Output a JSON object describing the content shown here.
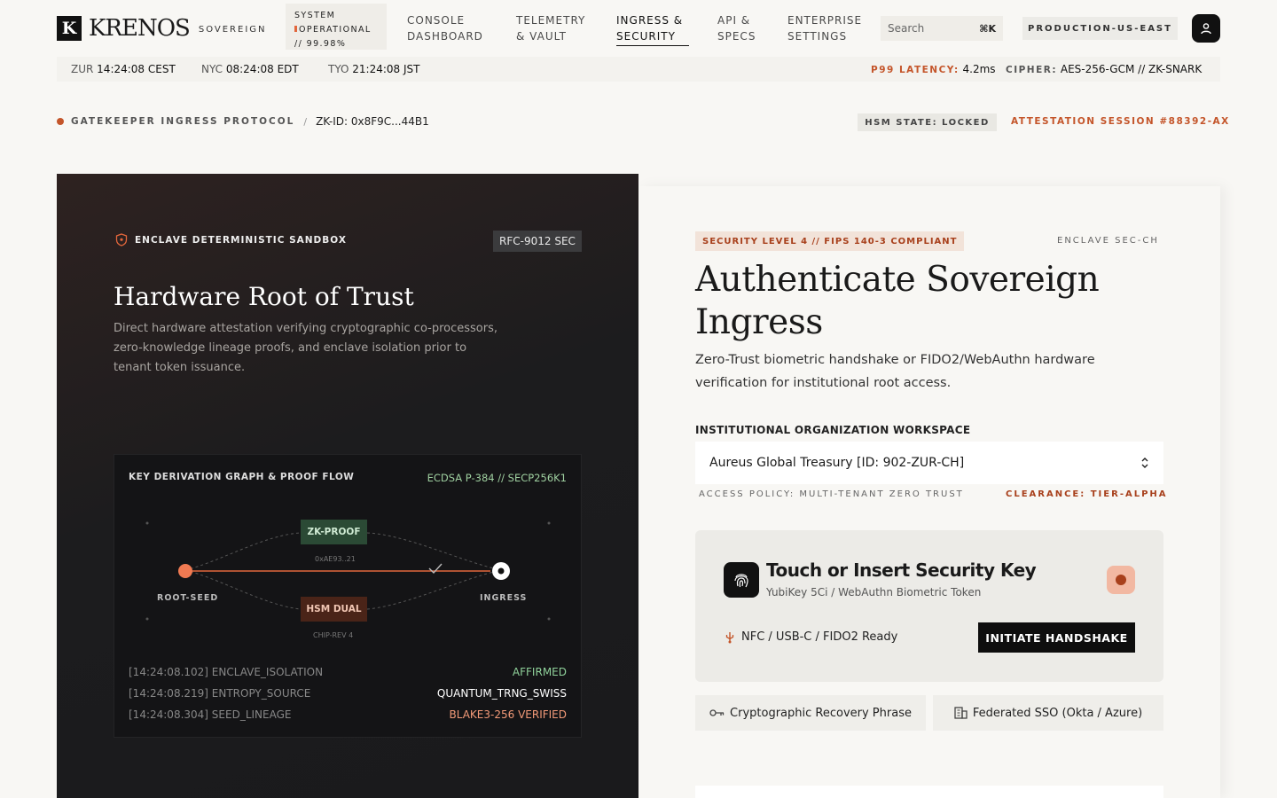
{
  "brand": {
    "mark": "K",
    "name": "KRENOS",
    "sub": "SOVEREIGN"
  },
  "system": {
    "line1": "SYSTEM",
    "line2": "OPERATIONAL",
    "line3": "// 99.98%"
  },
  "nav": [
    {
      "l1": "CONSOLE",
      "l2": "DASHBOARD"
    },
    {
      "l1": "TELEMETRY",
      "l2": "& VAULT"
    },
    {
      "l1": "INGRESS &",
      "l2": "SECURITY"
    },
    {
      "l1": "API &",
      "l2": "SPECS"
    },
    {
      "l1": "ENTERPRISE",
      "l2": "SETTINGS"
    }
  ],
  "search": {
    "placeholder": "Search",
    "shortcut": "⌘K"
  },
  "env": "PRODUCTION-US-EAST",
  "timebar": {
    "zur_label": "ZUR",
    "zur_time": "14:24:08 CEST",
    "nyc_label": "NYC",
    "nyc_time": "08:24:08 EDT",
    "tyo_label": "TYO",
    "tyo_time": "21:24:08 JST",
    "latency_label": "P99 LATENCY:",
    "latency_value": "4.2ms",
    "cipher_label": "CIPHER:",
    "cipher_value": "AES-256-GCM // ZK-SNARK"
  },
  "breadcrumb": {
    "protocol": "GATEKEEPER INGRESS PROTOCOL",
    "sep": "/",
    "zk": "ZK-ID: 0x8F9C...44B1"
  },
  "hsm_state": "HSM STATE: LOCKED",
  "attestation": "ATTESTATION SESSION #88392-AX",
  "left": {
    "sandbox": "ENCLAVE DETERMINISTIC SANDBOX",
    "rfc": "RFC-9012 SEC",
    "title": "Hardware Root of Trust",
    "desc": "Direct hardware attestation verifying cryptographic co-processors, zero-knowledge lineage proofs, and enclave isolation prior to tenant token issuance.",
    "graph": {
      "title": "KEY DERIVATION GRAPH & PROOF FLOW",
      "algo": "ECDSA P-384 // SECP256K1",
      "root": "ROOT-SEED",
      "ingress": "INGRESS",
      "zk": "ZK-PROOF",
      "zk_hash": "0xAE93..21",
      "hsm": "HSM DUAL",
      "hsm_rev": "CHIP-REV 4"
    },
    "logs": [
      {
        "text": "[14:24:08.102] ENCLAVE_ISOLATION",
        "value": "AFFIRMED",
        "color": "#8fd19a"
      },
      {
        "text": "[14:24:08.219] ENTROPY_SOURCE",
        "value": "QUANTUM_TRNG_SWISS",
        "color": "#ffffff"
      },
      {
        "text": "[14:24:08.304] SEED_LINEAGE",
        "value": "BLAKE3-256 VERIFIED",
        "color": "#f39a78"
      }
    ]
  },
  "right": {
    "badge": "SECURITY LEVEL 4 // FIPS 140-3 COMPLIANT",
    "enclave": "ENCLAVE SEC-CH",
    "title": "Authenticate Sovereign Ingress",
    "desc": "Zero-Trust biometric handshake or FIDO2/WebAuthn hardware verification for institutional root access.",
    "ws_label": "INSTITUTIONAL ORGANIZATION WORKSPACE",
    "ws_value": "Aureus Global Treasury [ID: 902-ZUR-CH]",
    "policy": "ACCESS POLICY: MULTI-TENANT ZERO TRUST",
    "clearance": "CLEARANCE: TIER-ALPHA",
    "key_title": "Touch or Insert Security Key",
    "key_sub": "YubiKey 5Ci / WebAuthn Biometric Token",
    "nfc": "NFC / USB-C / FIDO2 Ready",
    "handshake": "INITIATE HANDSHAKE",
    "recovery": "Cryptographic Recovery Phrase",
    "sso": "Federated SSO (Okta / Azure)"
  },
  "colors": {
    "accent": "#c4552a",
    "dark": "#1a1a1c",
    "success": "#8fd19a"
  }
}
